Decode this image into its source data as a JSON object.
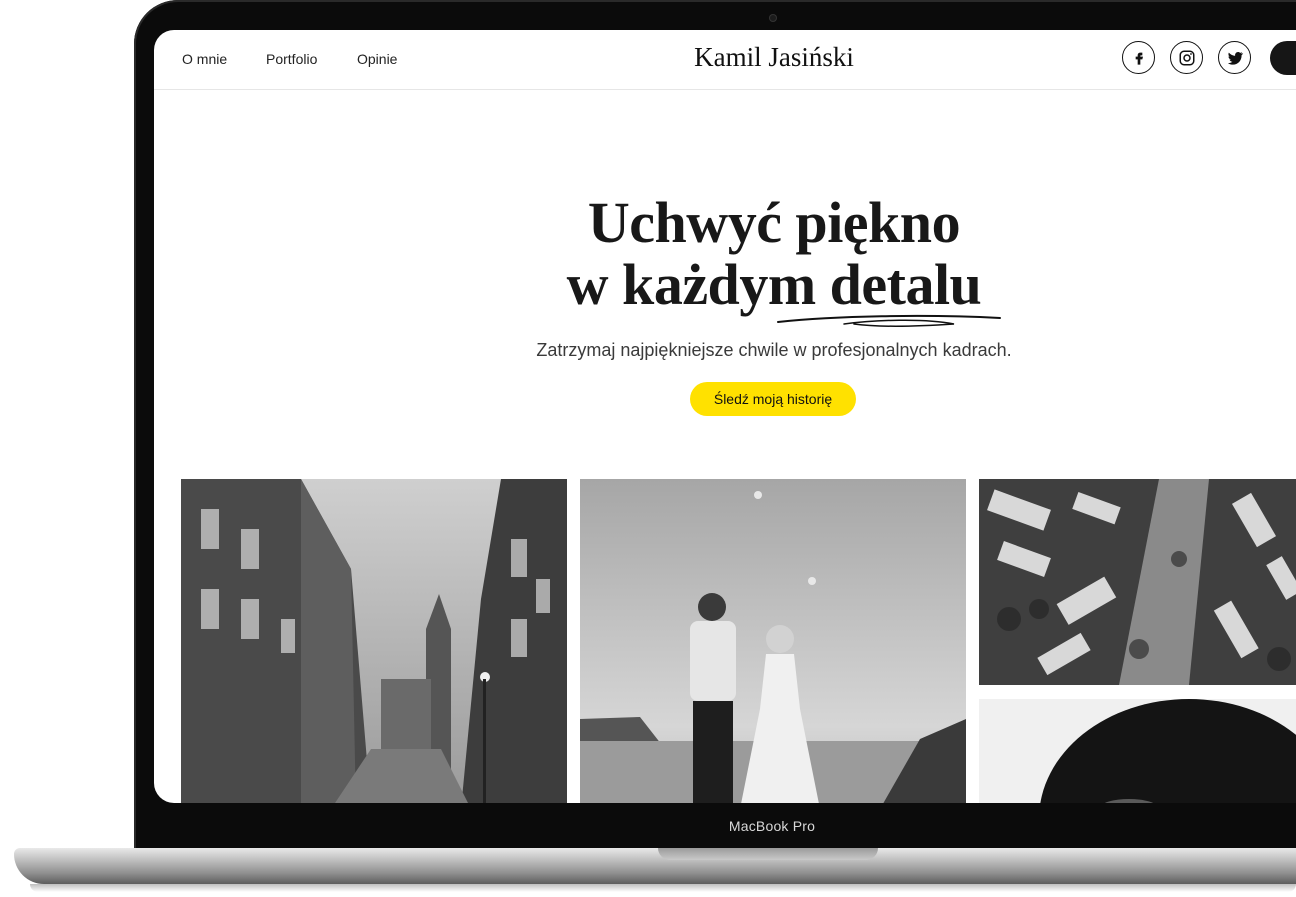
{
  "nav": {
    "links": [
      "O mnie",
      "Portfolio",
      "Opinie"
    ],
    "brand": "Kamil Jasiński",
    "social_icons": [
      "facebook-icon",
      "instagram-icon",
      "twitter-icon"
    ]
  },
  "hero": {
    "title_line1": "Uchwyć piękno",
    "title_line2": "w każdym detalu",
    "subtitle": "Zatrzymaj najpiękniejsze chwile w profesjonalnych kadrach.",
    "button_label": "Śledź moją historię"
  },
  "gallery": {
    "photos": [
      "old-town-street-photo",
      "wedding-couple-photo",
      "aerial-city-photo",
      "portrait-photo"
    ]
  },
  "device": {
    "label": "MacBook Pro"
  },
  "colors": {
    "accent": "#ffe100",
    "text": "#181818",
    "bezel": "#0b0b0b"
  }
}
